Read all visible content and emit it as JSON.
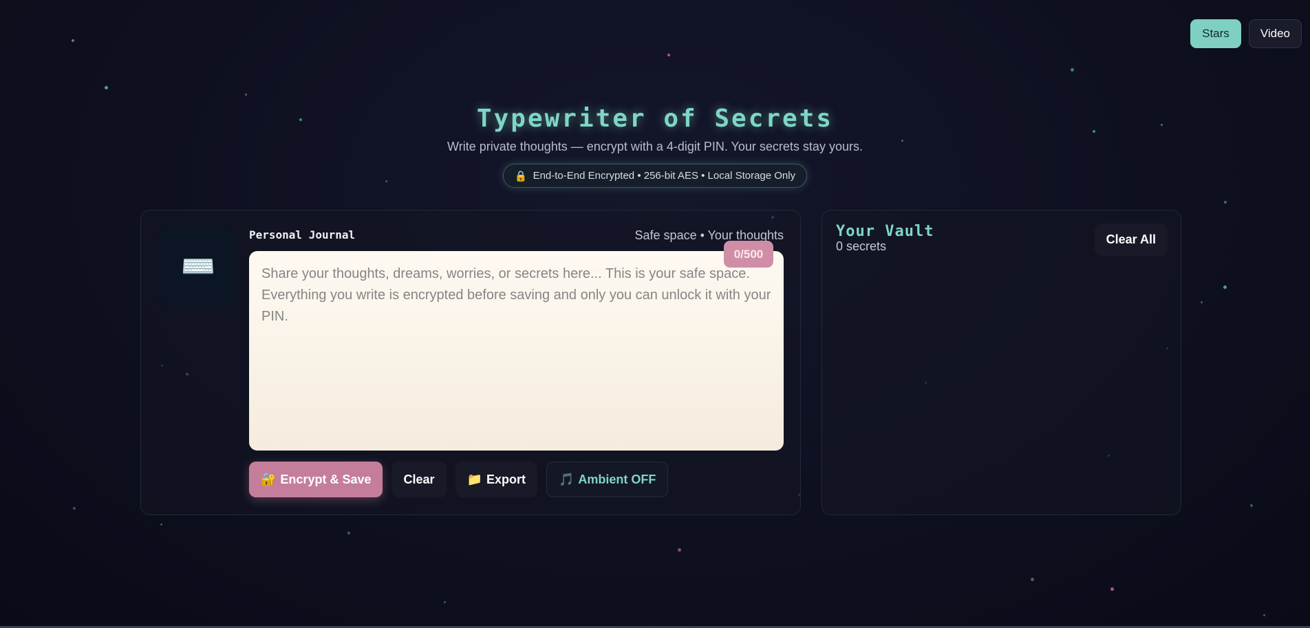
{
  "background_toggle": {
    "stars_label": "Stars",
    "video_label": "Video",
    "active": "Stars"
  },
  "header": {
    "title": "Typewriter of Secrets",
    "subtitle": "Write private thoughts — encrypt with a 4-digit PIN. Your secrets stay yours.",
    "badge_icon": "🔒",
    "badge_text": "End-to-End Encrypted • 256-bit AES • Local Storage Only"
  },
  "journal": {
    "icon": "⌨️",
    "title": "Personal Journal",
    "tagline": "Safe space • Your thoughts",
    "placeholder": "Share your thoughts, dreams, worries, or secrets here... This is your safe space. Everything you write is encrypted before saving and only you can unlock it with your PIN.",
    "value": "",
    "char_count": "0/500",
    "actions": {
      "encrypt_icon": "🔐",
      "encrypt_label": "Encrypt & Save",
      "clear_label": "Clear",
      "export_icon": "📁",
      "export_label": "Export",
      "ambient_icon": "🎵",
      "ambient_label": "Ambient OFF"
    }
  },
  "vault": {
    "title": "Your Vault",
    "count": "0 secrets",
    "clear_all_label": "Clear All"
  },
  "colors": {
    "accent_teal": "#7fd6c6",
    "accent_pink": "#c47e9c",
    "counter_pink": "#d08ea6",
    "background": "#0e1020"
  }
}
